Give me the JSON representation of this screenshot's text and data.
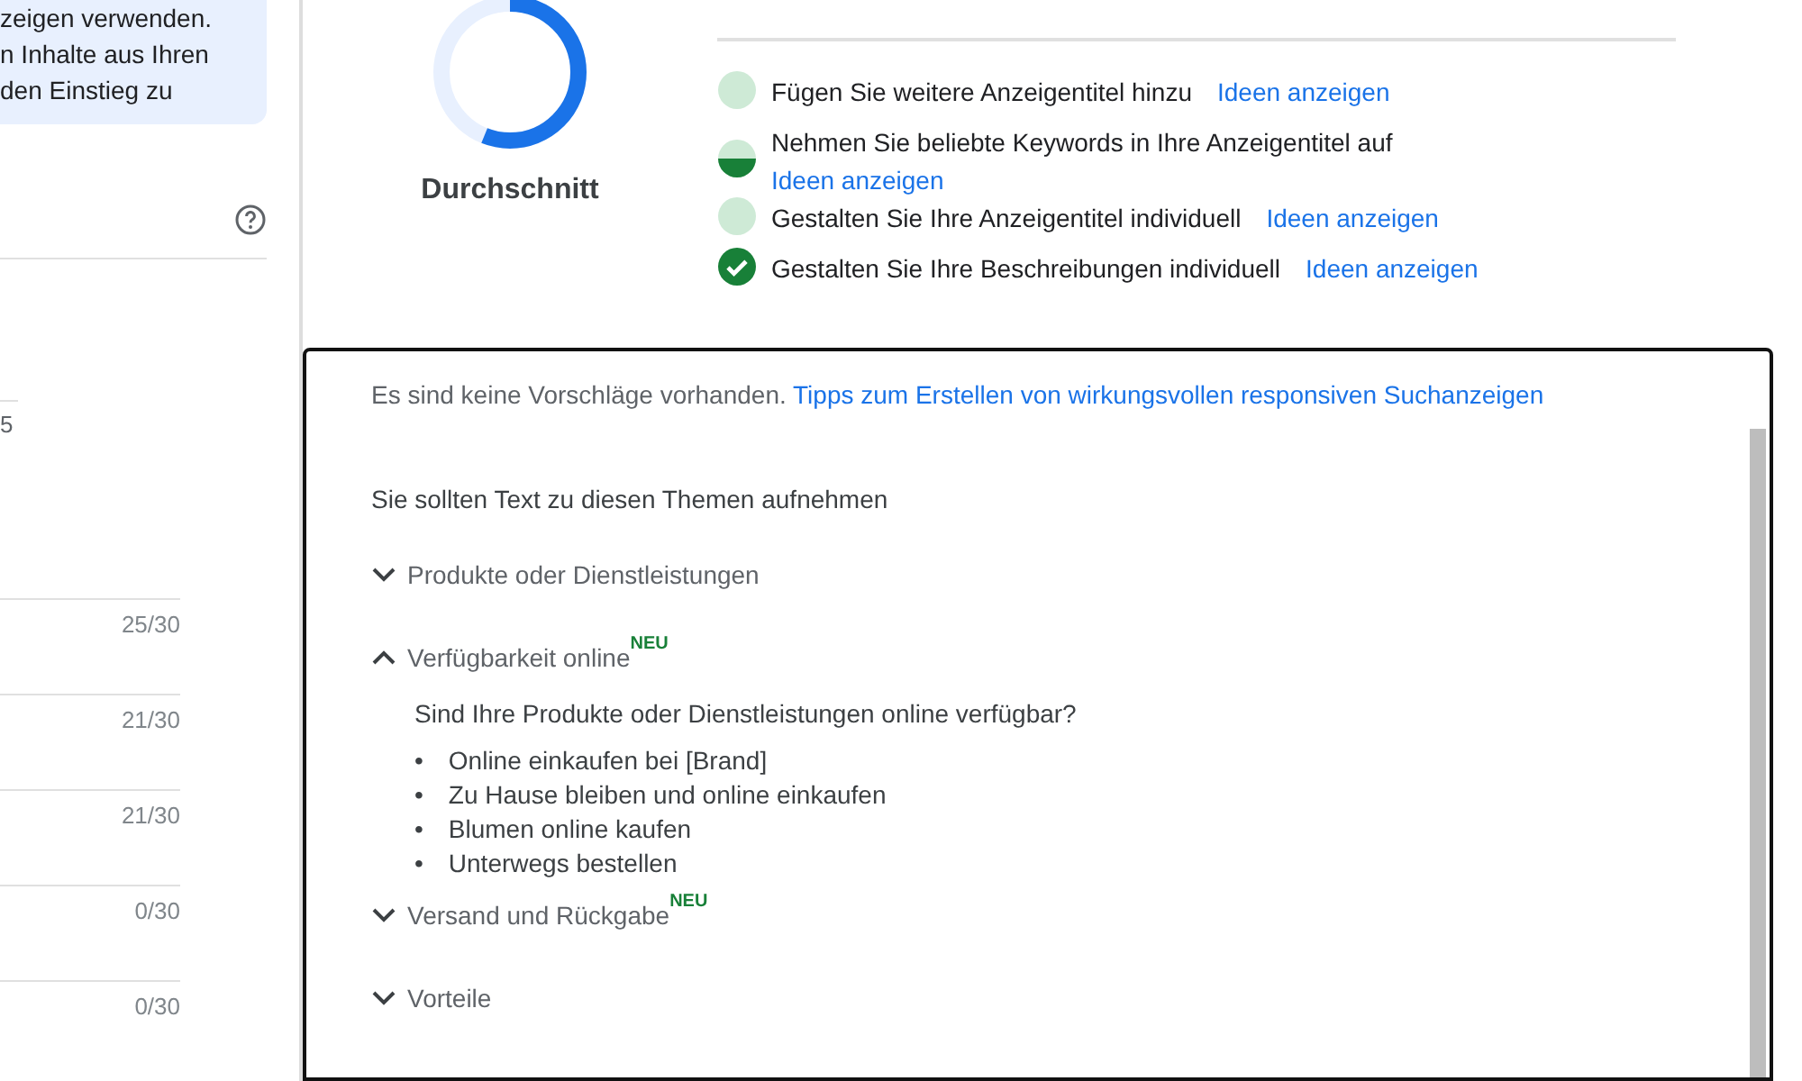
{
  "info_box": {
    "lines": [
      "zeigen verwenden.",
      "n Inhalte aus Ihren",
      "den Einstieg zu"
    ]
  },
  "left_panel": {
    "partial_value": "5",
    "counters": [
      "25/30",
      "21/30",
      "21/30",
      "0/30",
      "0/30"
    ]
  },
  "ad_strength": {
    "label": "Durchschnitt"
  },
  "checklist": [
    {
      "text": "Fügen Sie weitere Anzeigentitel hinzu",
      "link": "Ideen anzeigen",
      "kind": "empty",
      "wrap": false
    },
    {
      "text": "Nehmen Sie beliebte Keywords in Ihre Anzeigentitel auf",
      "link": "Ideen anzeigen",
      "kind": "half",
      "wrap": true
    },
    {
      "text": "Gestalten Sie Ihre Anzeigentitel individuell",
      "link": "Ideen anzeigen",
      "kind": "empty",
      "wrap": false
    },
    {
      "text": "Gestalten Sie Ihre Beschreibungen individuell",
      "link": "Ideen anzeigen",
      "kind": "done",
      "wrap": false
    }
  ],
  "suggestions": {
    "notice": "Es sind keine Vorschläge vorhanden.",
    "tips_link": "Tipps zum Erstellen von wirkungsvollen responsiven Suchanzeigen",
    "intro": "Sie sollten Text zu diesen Themen aufnehmen",
    "topics": [
      {
        "title": "Produkte oder Dienstleistungen",
        "expanded": false
      },
      {
        "title": "Verfügbarkeit online",
        "new_badge": "NEU",
        "expanded": true,
        "question": "Sind Ihre Produkte oder Dienstleistungen online verfügbar?",
        "examples": [
          {
            "marker": "•",
            "text": "Online einkaufen bei [Brand]"
          },
          {
            "marker": "•",
            "text": "Zu Hause bleiben und online einkaufen"
          },
          {
            "marker": "•",
            "text": "Blumen online kaufen"
          },
          {
            "marker": "•",
            "text": "Unterwegs bestellen"
          }
        ]
      },
      {
        "title": "Versand und Rückgabe",
        "new_badge": "NEU",
        "expanded": false
      },
      {
        "title": "Vorteile",
        "expanded": false
      }
    ]
  }
}
